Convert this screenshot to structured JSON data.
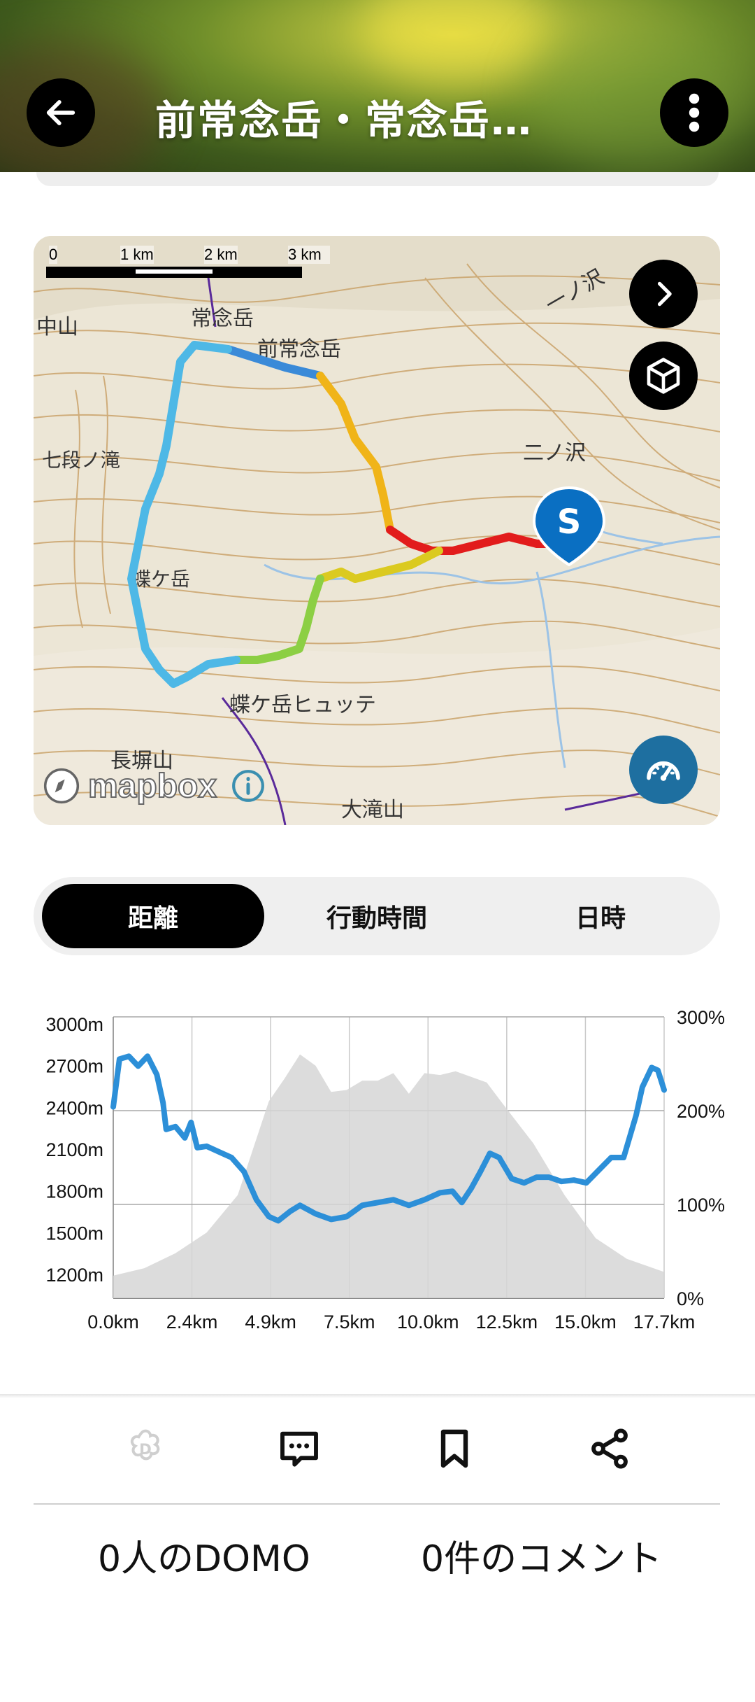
{
  "header": {
    "title": "前常念岳・常念岳…",
    "back_icon": "arrow-left-icon",
    "menu_icon": "more-vertical-icon"
  },
  "map": {
    "scale_labels": [
      "0",
      "1 km",
      "2 km",
      "3 km"
    ],
    "place_labels": [
      "常念岳",
      "前常念岳",
      "一ノ沢",
      "中山",
      "七段ノ滝",
      "蝶ケ岳",
      "蝶ケ岳ヒュッテ",
      "長塀山",
      "大滝山",
      "二ノ沢"
    ],
    "start_marker": "S",
    "attribution": "mapbox",
    "next_icon": "chevron-right-icon",
    "view3d_icon": "cube-icon",
    "speed_icon": "speedometer-icon",
    "info_icon": "info-icon"
  },
  "tabs": [
    {
      "label": "距離",
      "active": true
    },
    {
      "label": "行動時間",
      "active": false
    },
    {
      "label": "日時",
      "active": false
    }
  ],
  "chart_data": {
    "type": "line",
    "x_tick_labels": [
      "0.0km",
      "2.4km",
      "4.9km",
      "7.5km",
      "10.0km",
      "12.5km",
      "15.0km",
      "17.7km"
    ],
    "y_left_tick_labels": [
      "3000m",
      "2700m",
      "2400m",
      "2100m",
      "1800m",
      "1500m",
      "1200m"
    ],
    "y_right_tick_labels": [
      "300%",
      "200%",
      "100%",
      "0%"
    ],
    "xlim": [
      0,
      17.7
    ],
    "ylim": [
      1000,
      3000
    ],
    "grid": true,
    "series": [
      {
        "kind": "elevation",
        "x": [
          0,
          0.2,
          0.5,
          0.8,
          1.1,
          1.4,
          1.6,
          1.7,
          2.0,
          2.3,
          2.5,
          2.7,
          3.0,
          3.4,
          3.8,
          4.2,
          4.6,
          5.0,
          5.3,
          5.7,
          6.0,
          6.5,
          7.0,
          7.5,
          8.0,
          8.5,
          9.0,
          9.5,
          10.0,
          10.5,
          10.9,
          11.2,
          11.5,
          11.8,
          12.1,
          12.4,
          12.8,
          13.2,
          13.6,
          14.0,
          14.4,
          14.8,
          15.2,
          15.6,
          16.0,
          16.4,
          16.8,
          17.0,
          17.3,
          17.5,
          17.7
        ],
        "y": [
          2360,
          2700,
          2720,
          2650,
          2720,
          2590,
          2390,
          2200,
          2220,
          2140,
          2250,
          2070,
          2080,
          2040,
          2000,
          1900,
          1700,
          1580,
          1550,
          1620,
          1660,
          1600,
          1560,
          1580,
          1660,
          1680,
          1700,
          1660,
          1700,
          1750,
          1760,
          1680,
          1780,
          1900,
          2030,
          2000,
          1850,
          1820,
          1860,
          1860,
          1830,
          1840,
          1820,
          1910,
          2000,
          2000,
          2300,
          2500,
          2640,
          2620,
          2480
        ]
      },
      {
        "kind": "slope",
        "x": [
          0,
          1.0,
          2.0,
          3.0,
          4.0,
          5.0,
          5.5,
          6.0,
          6.5,
          7.0,
          7.5,
          8.0,
          8.5,
          9.0,
          9.5,
          10.0,
          10.5,
          11.0,
          11.5,
          12.0,
          12.5,
          13.5,
          14.5,
          15.5,
          16.5,
          17.7
        ],
        "y": [
          24,
          32,
          48,
          70,
          110,
          210,
          234,
          260,
          248,
          220,
          222,
          232,
          232,
          240,
          218,
          240,
          238,
          242,
          236,
          230,
          208,
          165,
          110,
          64,
          42,
          28
        ]
      }
    ]
  },
  "actions": [
    {
      "name": "domo",
      "icon": "domo-flower-icon"
    },
    {
      "name": "comment",
      "icon": "comment-icon"
    },
    {
      "name": "bookmark",
      "icon": "bookmark-icon"
    },
    {
      "name": "share",
      "icon": "share-icon"
    }
  ],
  "stats": {
    "domo": "0人のDOMO",
    "comments": "0件のコメント"
  },
  "colors": {
    "accent_black": "#000000",
    "speed_button": "#1e6fa0",
    "start_marker": "#0a6fc2",
    "slope_fill": "#d6d6d6"
  }
}
